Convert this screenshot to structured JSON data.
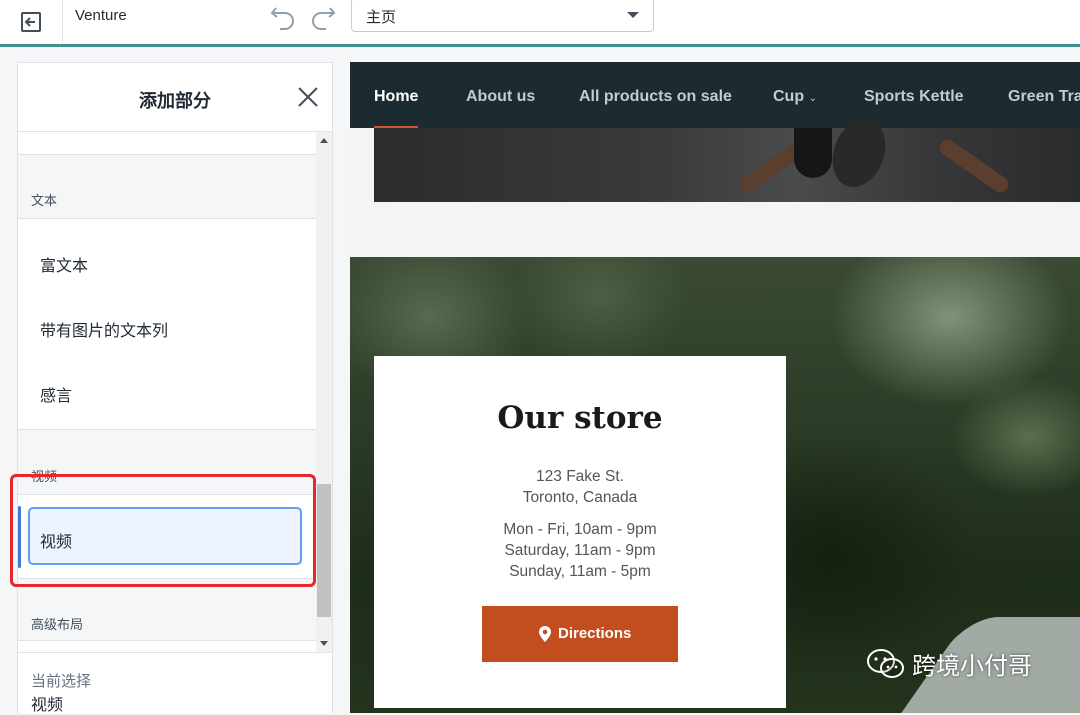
{
  "topbar": {
    "theme_name": "Venture",
    "page_select_value": "主页"
  },
  "panel": {
    "title": "添加部分",
    "groups": {
      "text_group": "文本",
      "video_group": "视频",
      "advanced_group": "高级布局"
    },
    "text_items": [
      "富文本",
      "带有图片的文本列",
      "感言"
    ],
    "video_item": "视频",
    "current_label": "当前选择",
    "current_value": "视频"
  },
  "preview": {
    "nav": [
      "Home",
      "About us",
      "All products on sale",
      "Cup",
      "Sports Kettle",
      "Green Tra"
    ],
    "active_nav": "Home",
    "store": {
      "title": "Our store",
      "address_line1": "123 Fake St.",
      "address_line2": "Toronto, Canada",
      "hours1": "Mon - Fri, 10am - 9pm",
      "hours2": "Saturday, 11am - 9pm",
      "hours3": "Sunday, 11am - 5pm",
      "button": "Directions"
    }
  },
  "watermark": "跨境小付哥",
  "colors": {
    "accent_teal": "#3f8f8c",
    "selection_blue": "#5c9ff5",
    "highlight_red": "#e8262b",
    "nav_bg": "#1c2b2f",
    "button_orange": "#c24d1e"
  }
}
